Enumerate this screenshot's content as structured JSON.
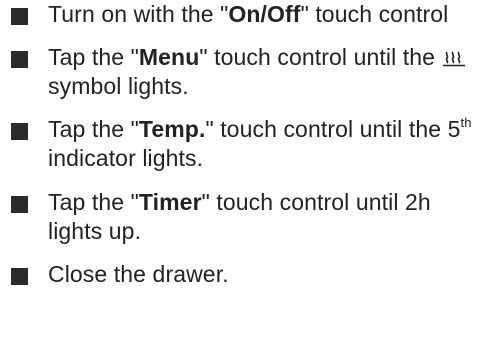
{
  "steps": [
    {
      "pre": "Turn on with the \"",
      "keyword": "On/Off",
      "post": "\" touch control"
    },
    {
      "pre": "Tap the \"",
      "keyword": "Menu",
      "mid": "\" touch control until the",
      "icon": "heating-symbol-icon",
      "post": " symbol lights."
    },
    {
      "pre": "Tap the \"",
      "keyword": "Temp.",
      "mid": "\" touch control until the 5",
      "sup": "th",
      "post": " indicator lights."
    },
    {
      "pre": "Tap the \"",
      "keyword": "Timer",
      "post": "\" touch control until 2h lights up."
    },
    {
      "text": "Close the drawer."
    }
  ]
}
